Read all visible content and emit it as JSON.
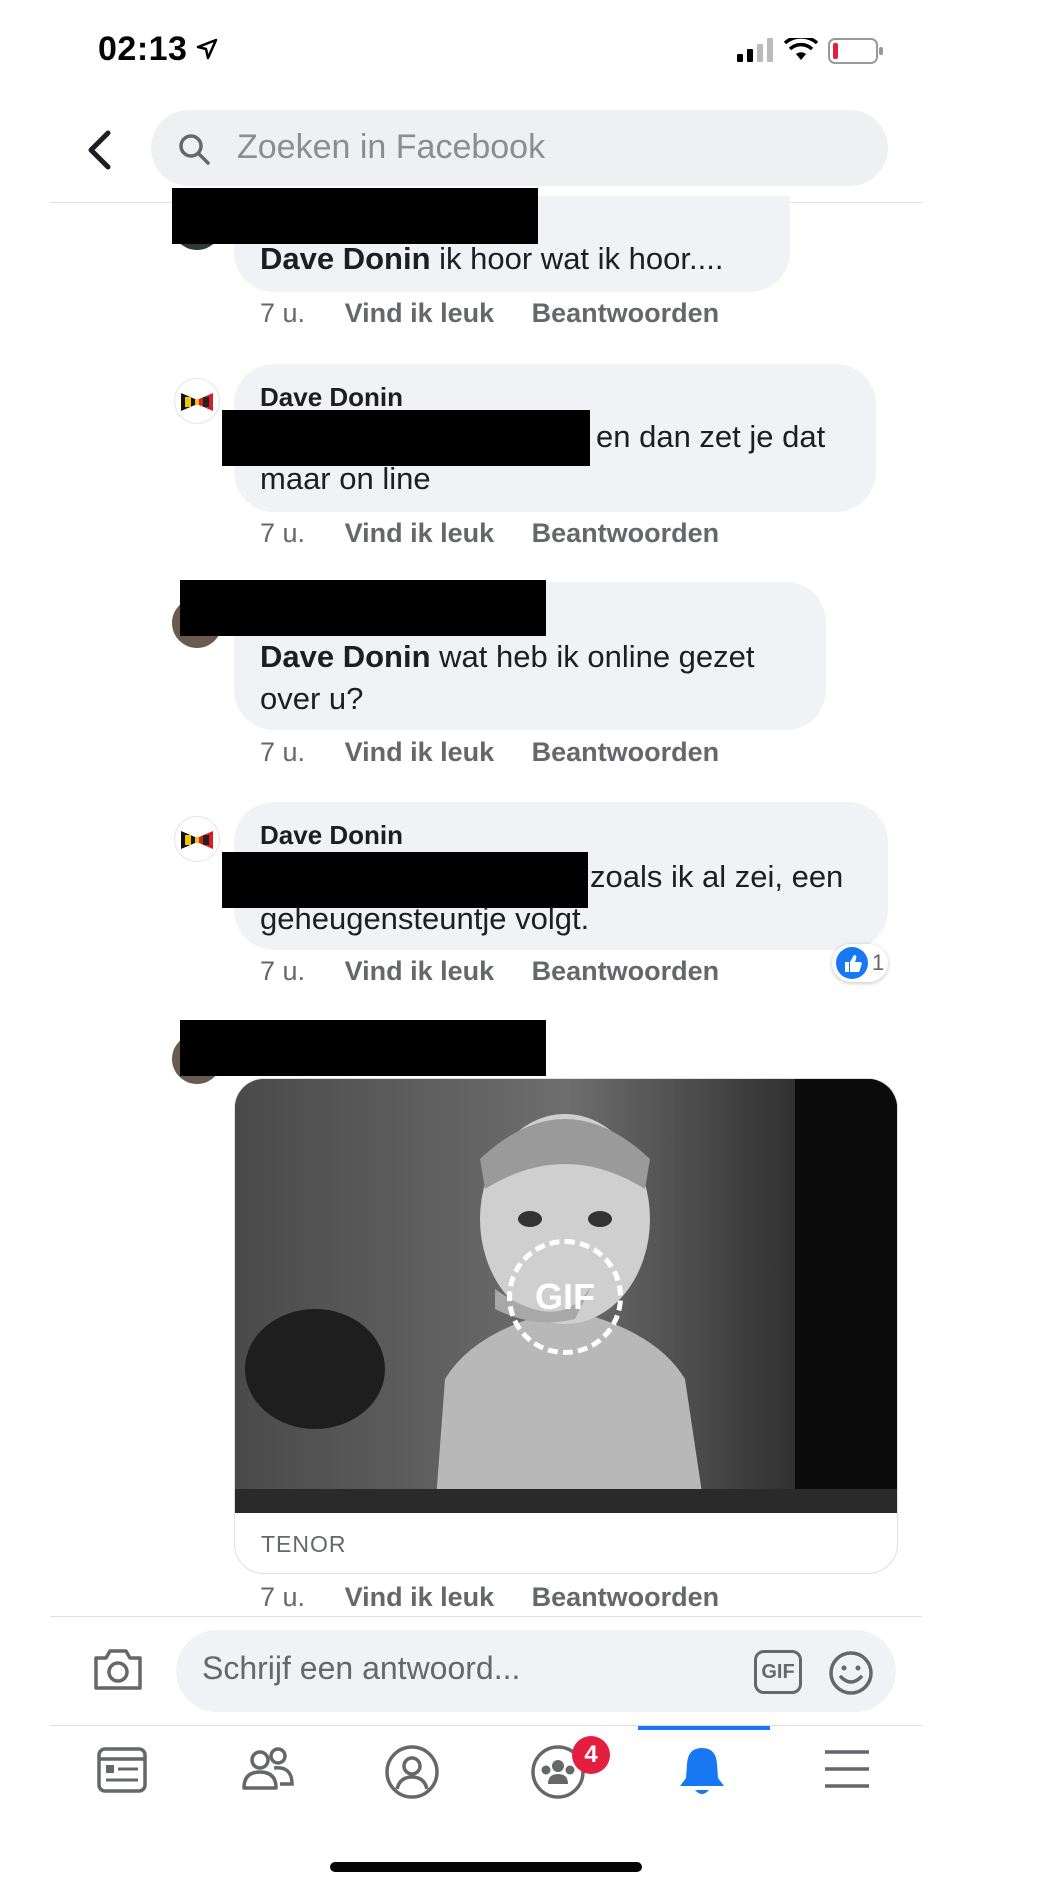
{
  "status_bar": {
    "time": "02:13"
  },
  "header": {
    "search_placeholder": "Zoeken in Facebook"
  },
  "comments": [
    {
      "name": "",
      "mention": "Dave Donin",
      "text": " ik hoor wat ik hoor....",
      "time": "7 u.",
      "like": "Vind ik leuk",
      "reply": "Beantwoorden"
    },
    {
      "name": "Dave Donin",
      "text_line1": "en dan zet je dat",
      "text_line2": "maar on line",
      "time": "7 u.",
      "like": "Vind ik leuk",
      "reply": "Beantwoorden"
    },
    {
      "name": "",
      "mention": "Dave Donin",
      "text_line1": " wat heb ik online gezet",
      "text_line2": "over u?",
      "time": "7 u.",
      "like": "Vind ik leuk",
      "reply": "Beantwoorden"
    },
    {
      "name": "Dave Donin",
      "text_line1": "zoals ik al zei, een",
      "text_line2": "geheugensteuntje volgt.",
      "time": "7 u.",
      "like": "Vind ik leuk",
      "reply": "Beantwoorden",
      "reactions": "1"
    },
    {
      "name": "",
      "gif_label": "GIF",
      "gif_source": "TENOR",
      "time": "7 u.",
      "like": "Vind ik leuk",
      "reply": "Beantwoorden"
    }
  ],
  "composer": {
    "placeholder": "Schrijf een antwoord...",
    "gif_button": "GIF"
  },
  "tabbar": {
    "items": [
      {
        "icon": "news-feed-icon"
      },
      {
        "icon": "friends-icon"
      },
      {
        "icon": "profile-icon"
      },
      {
        "icon": "groups-icon",
        "badge": "4"
      },
      {
        "icon": "notifications-bell-icon",
        "active": true
      },
      {
        "icon": "menu-icon"
      }
    ]
  },
  "colors": {
    "accent": "#1877f2",
    "badge": "#e41e3f",
    "bubble": "#f0f2f5"
  }
}
